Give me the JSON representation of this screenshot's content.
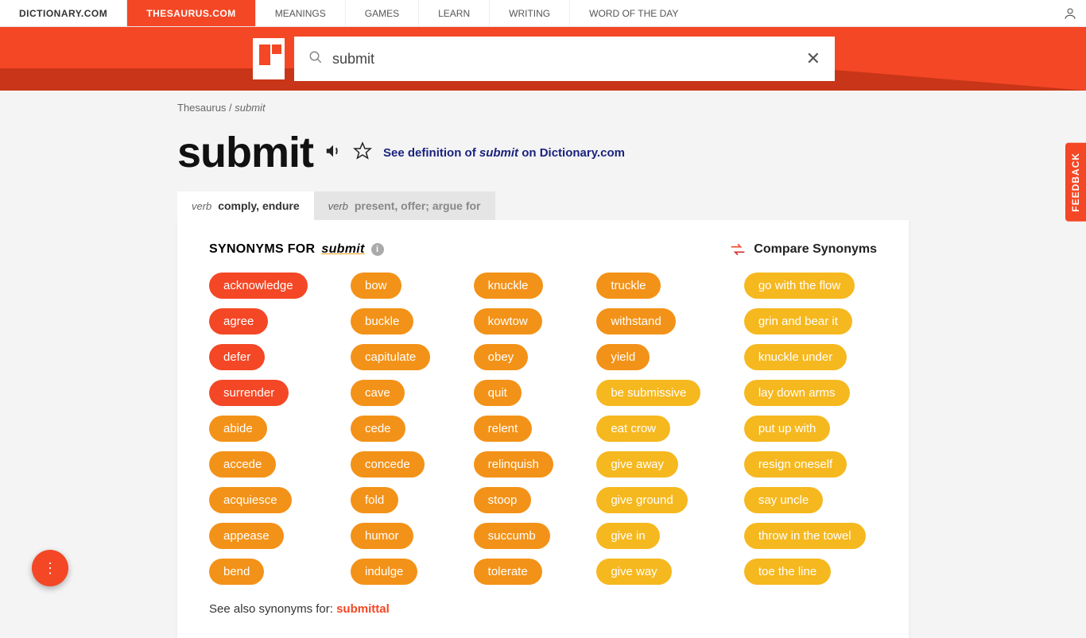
{
  "nav": {
    "tabs": [
      {
        "label": "DICTIONARY.COM",
        "active": false
      },
      {
        "label": "THESAURUS.COM",
        "active": true
      }
    ],
    "links": [
      "MEANINGS",
      "GAMES",
      "LEARN",
      "WRITING",
      "WORD OF THE DAY"
    ]
  },
  "search": {
    "value": "submit"
  },
  "breadcrumb": {
    "root": "Thesaurus",
    "sep": " / ",
    "word": "submit"
  },
  "headword": "submit",
  "definition_link": {
    "prefix": "See definition of ",
    "word": "submit",
    "suffix": " on Dictionary.com"
  },
  "senses": [
    {
      "pos": "verb",
      "text": "comply, endure",
      "active": true
    },
    {
      "pos": "verb",
      "text": "present, offer; argue for",
      "active": false
    }
  ],
  "panel": {
    "heading_prefix": "SYNONYMS FOR ",
    "heading_word": "submit",
    "compare_label": "Compare Synonyms",
    "see_also_prefix": "See also synonyms for: ",
    "see_also_link": "submittal"
  },
  "synonyms": [
    [
      {
        "w": "acknowledge",
        "r": 1
      },
      {
        "w": "agree",
        "r": 1
      },
      {
        "w": "defer",
        "r": 1
      },
      {
        "w": "surrender",
        "r": 1
      },
      {
        "w": "abide",
        "r": 2
      },
      {
        "w": "accede",
        "r": 2
      },
      {
        "w": "acquiesce",
        "r": 2
      },
      {
        "w": "appease",
        "r": 2
      },
      {
        "w": "bend",
        "r": 2
      }
    ],
    [
      {
        "w": "bow",
        "r": 2
      },
      {
        "w": "buckle",
        "r": 2
      },
      {
        "w": "capitulate",
        "r": 2
      },
      {
        "w": "cave",
        "r": 2
      },
      {
        "w": "cede",
        "r": 2
      },
      {
        "w": "concede",
        "r": 2
      },
      {
        "w": "fold",
        "r": 2
      },
      {
        "w": "humor",
        "r": 2
      },
      {
        "w": "indulge",
        "r": 2
      }
    ],
    [
      {
        "w": "knuckle",
        "r": 2
      },
      {
        "w": "kowtow",
        "r": 2
      },
      {
        "w": "obey",
        "r": 2
      },
      {
        "w": "quit",
        "r": 2
      },
      {
        "w": "relent",
        "r": 2
      },
      {
        "w": "relinquish",
        "r": 2
      },
      {
        "w": "stoop",
        "r": 2
      },
      {
        "w": "succumb",
        "r": 2
      },
      {
        "w": "tolerate",
        "r": 2
      }
    ],
    [
      {
        "w": "truckle",
        "r": 2
      },
      {
        "w": "withstand",
        "r": 2
      },
      {
        "w": "yield",
        "r": 2
      },
      {
        "w": "be submissive",
        "r": 3
      },
      {
        "w": "eat crow",
        "r": 3
      },
      {
        "w": "give away",
        "r": 3
      },
      {
        "w": "give ground",
        "r": 3
      },
      {
        "w": "give in",
        "r": 3
      },
      {
        "w": "give way",
        "r": 3
      }
    ],
    [
      {
        "w": "go with the flow",
        "r": 3
      },
      {
        "w": "grin and bear it",
        "r": 3
      },
      {
        "w": "knuckle under",
        "r": 3
      },
      {
        "w": "lay down arms",
        "r": 3
      },
      {
        "w": "put up with",
        "r": 3
      },
      {
        "w": "resign oneself",
        "r": 3
      },
      {
        "w": "say uncle",
        "r": 3
      },
      {
        "w": "throw in the towel",
        "r": 3
      },
      {
        "w": "toe the line",
        "r": 3
      }
    ]
  ],
  "feedback_label": "FEEDBACK"
}
